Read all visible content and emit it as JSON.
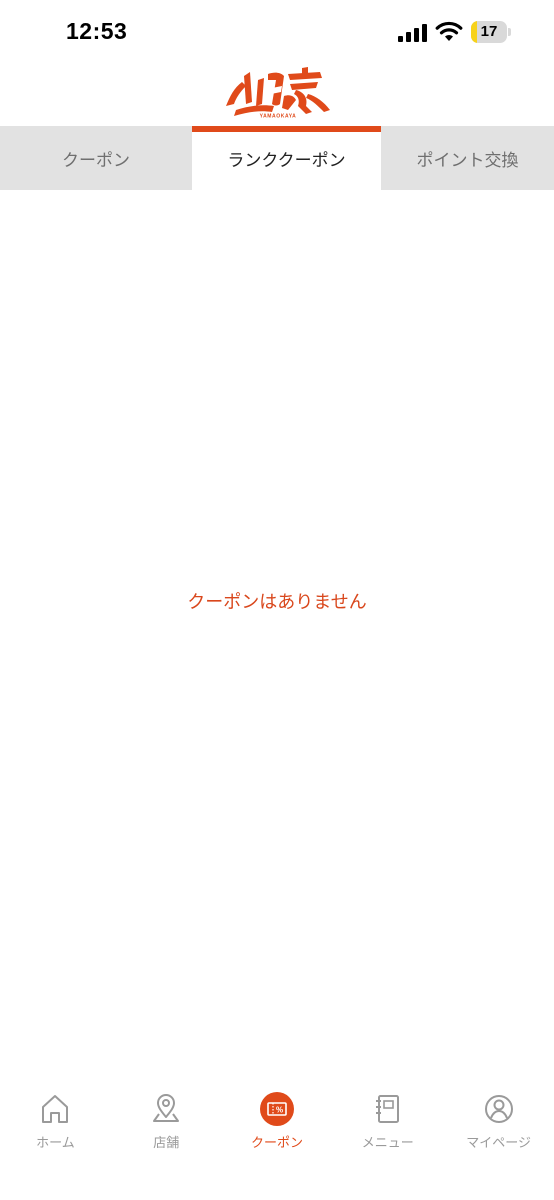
{
  "status_bar": {
    "time": "12:53",
    "battery_level": "17",
    "battery_percent": 17,
    "signal_icon": "cellular-signal-icon",
    "wifi_icon": "wifi-icon"
  },
  "header": {
    "logo_icon": "yamaokaya-logo-icon",
    "logo_text": "山岡家",
    "logo_subtext": "YAMAOKAYA"
  },
  "tabs": [
    {
      "label": "クーポン",
      "active": false
    },
    {
      "label": "ランククーポン",
      "active": true
    },
    {
      "label": "ポイント交換",
      "active": false
    }
  ],
  "content": {
    "empty_message": "クーポンはありません"
  },
  "bottom_nav": [
    {
      "label": "ホーム",
      "icon": "home-icon",
      "active": false
    },
    {
      "label": "店舗",
      "icon": "map-pin-icon",
      "active": false
    },
    {
      "label": "クーポン",
      "icon": "coupon-icon",
      "active": true
    },
    {
      "label": "メニュー",
      "icon": "menu-book-icon",
      "active": false
    },
    {
      "label": "マイページ",
      "icon": "user-icon",
      "active": false
    }
  ],
  "colors": {
    "accent": "#e04a1a",
    "tab_inactive_bg": "#e2e2e2",
    "nav_inactive": "#9a9a9a",
    "battery_fill": "#f7d21a"
  }
}
